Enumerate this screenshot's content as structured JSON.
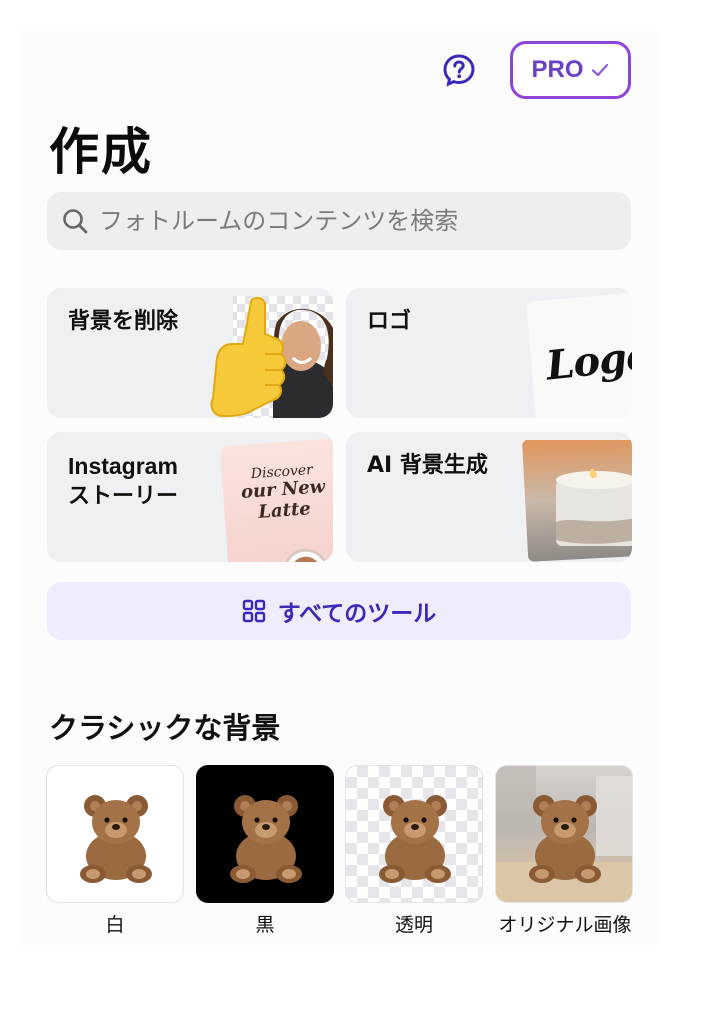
{
  "header": {
    "help_icon": "question-bubble-icon",
    "pro_label": "PRO",
    "pro_icon": "check-icon",
    "accent": "#8e44d6"
  },
  "page_title": "作成",
  "search": {
    "placeholder": "フォトルームのコンテンツを検索",
    "value": ""
  },
  "tools": [
    {
      "label": "背景を削除"
    },
    {
      "label": "ロゴ",
      "image_text": "Logos"
    },
    {
      "label_line1": "Instagram",
      "label_line2": "ストーリー",
      "image_text_1": "Discover",
      "image_text_2": "our New",
      "image_text_3": "Latte"
    },
    {
      "label": "AI 背景生成"
    }
  ],
  "all_tools": {
    "label": "すべてのツール",
    "icon": "grid-icon",
    "color": "#3b2ab8"
  },
  "classic": {
    "title": "クラシックな背景",
    "items": [
      {
        "label": "白"
      },
      {
        "label": "黒"
      },
      {
        "label": "透明"
      },
      {
        "label": "オリジナル画像"
      }
    ]
  }
}
